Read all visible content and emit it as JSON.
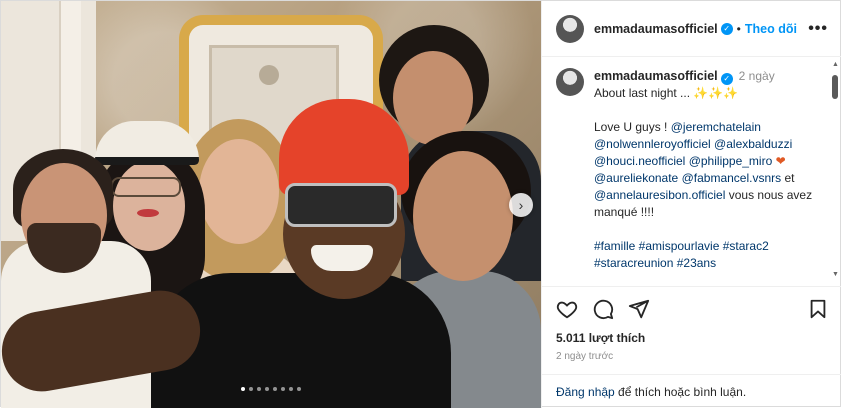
{
  "post": {
    "username": "emmadaumasofficiel",
    "follow_label": "Theo dõi",
    "more_label": "•••",
    "separator": "•",
    "caption": {
      "time": "2 ngày",
      "line1": "About last night ... ✨✨✨",
      "line2_prefix": "Love U guys ! ",
      "mentions_a": [
        "@jeremchatelain",
        "@nolwennleroyofficiel",
        "@alexbalduzzi",
        "@houci.neofficiel",
        "@philippe_miro"
      ],
      "heart": "❤",
      "mentions_b": [
        "@aureliekonate",
        "@fabmancel.vsnrs"
      ],
      "et": " et",
      "mentions_c": "@annelauresibon.officiel",
      "closing": " vous nous avez manqué !!!!",
      "hashtags": "#famille #amispourlavie #starac2 #staracreunion #23ans"
    },
    "likes": "5.011 lượt thích",
    "time_ago": "2 ngày trước",
    "login_link": "Đăng nhập",
    "login_rest": " để thích hoặc bình luận."
  },
  "carousel": {
    "total": 8,
    "active_index": 0
  },
  "colors": {
    "accent": "#0095f6",
    "link": "#00376b",
    "muted": "#8e8e8e"
  }
}
